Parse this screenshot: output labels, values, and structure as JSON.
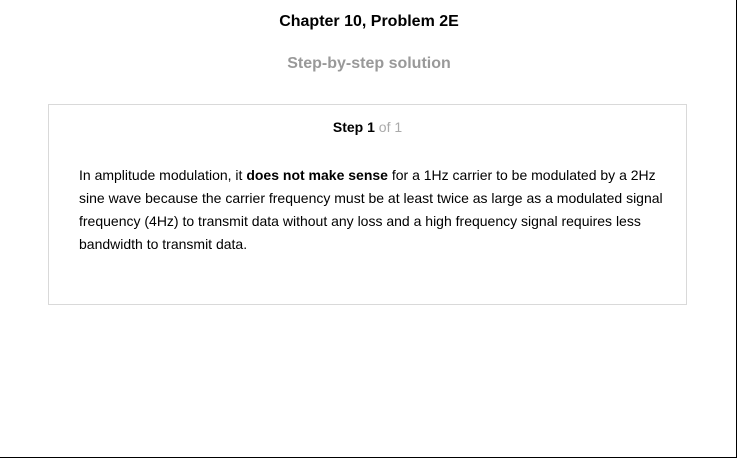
{
  "header": {
    "title": "Chapter 10, Problem 2E",
    "subtitle": "Step-by-step solution"
  },
  "step": {
    "label": "Step",
    "number": "1",
    "of_text": "of 1",
    "text_before": "In amplitude modulation, it ",
    "text_bold": "does not make sense",
    "text_after": " for a 1Hz carrier to be modulated by a 2Hz sine wave because the carrier frequency must be at least twice as large as a modulated signal frequency (4Hz) to transmit data without any loss and a high frequency signal requires less bandwidth to transmit data."
  },
  "colors": {
    "title": "#000000",
    "subtitle": "#999999",
    "step_of": "#aaaaaa",
    "card_border": "#d9d9d9",
    "frame_border": "#000000"
  }
}
